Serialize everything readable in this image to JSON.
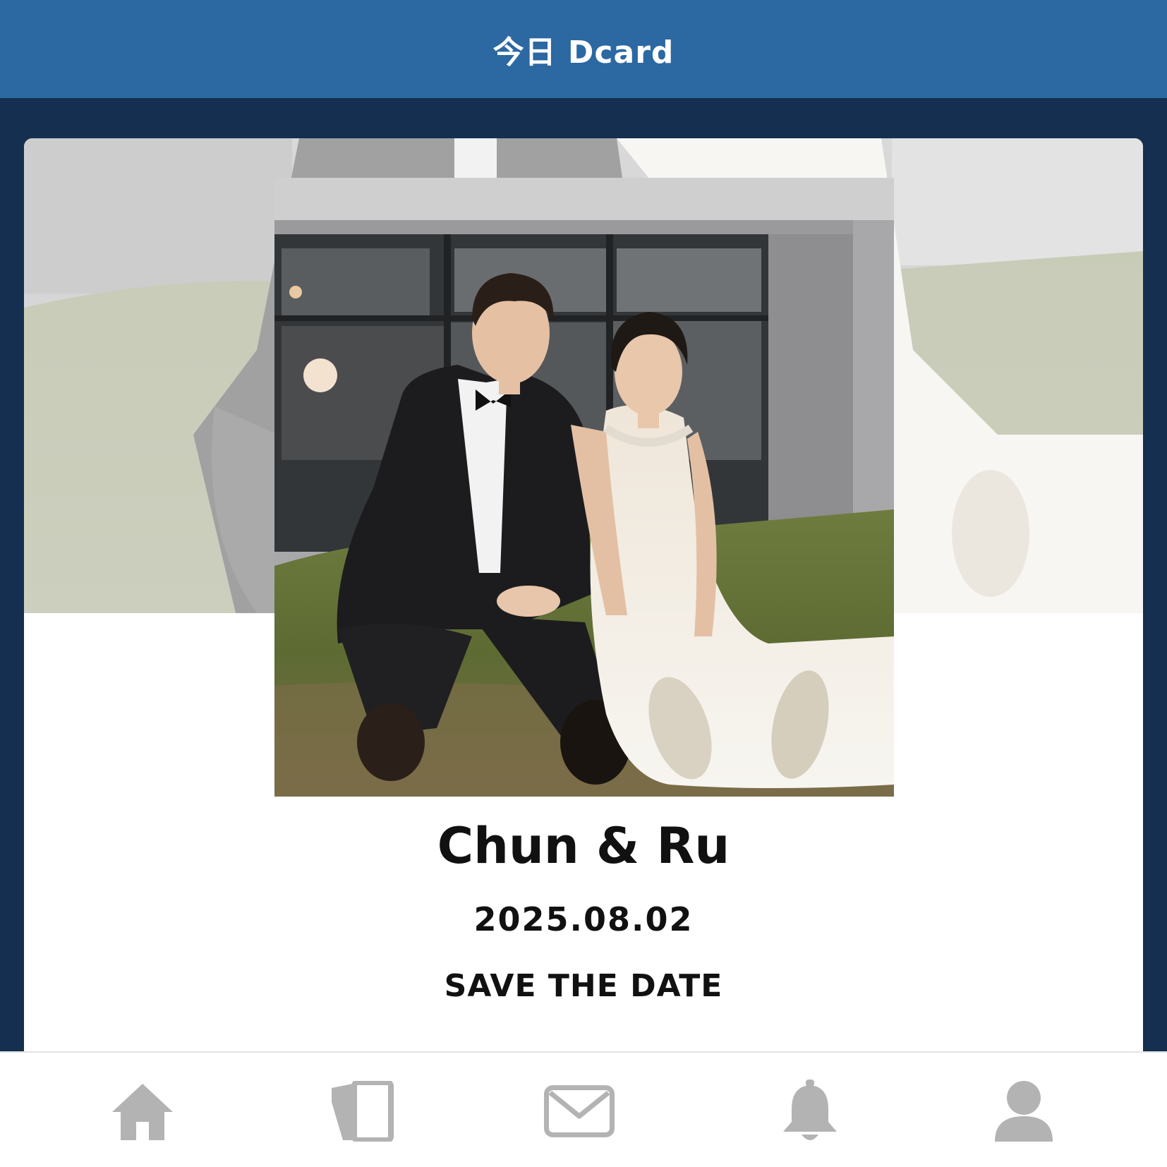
{
  "header": {
    "title": "今日 Dcard"
  },
  "invitation": {
    "names": "Chun & Ru",
    "date": "2025.08.02",
    "tagline": "SAVE THE DATE"
  },
  "bottom_nav": {
    "items": [
      {
        "icon": "home-icon"
      },
      {
        "icon": "cards-icon"
      },
      {
        "icon": "mail-icon"
      },
      {
        "icon": "bell-icon"
      },
      {
        "icon": "profile-icon"
      }
    ],
    "icon_color": "#b3b3b3"
  },
  "colors": {
    "header_bg": "#2c68a2",
    "page_bg": "#142f50",
    "card_bg": "#ffffff"
  }
}
